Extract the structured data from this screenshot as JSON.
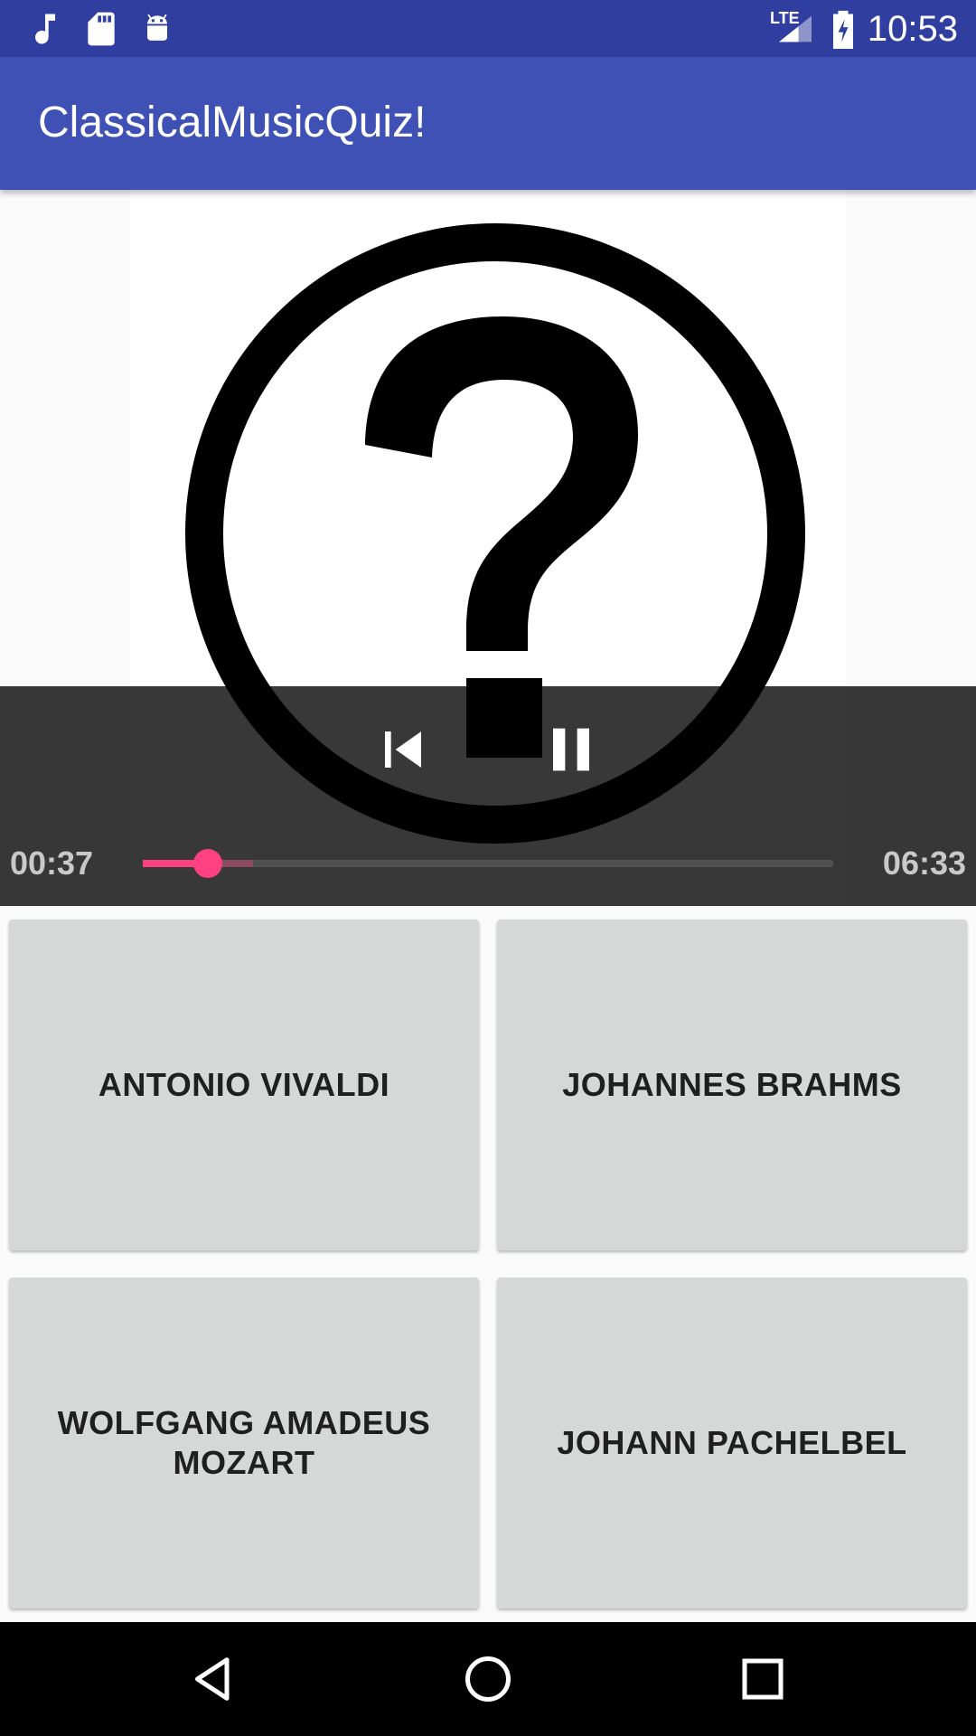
{
  "status_bar": {
    "time": "10:53",
    "network_label": "LTE",
    "left_icons": [
      "music-note-icon",
      "sd-card-icon",
      "android-icon"
    ],
    "right_icons": [
      "signal-icon",
      "battery-charging-icon"
    ]
  },
  "app_bar": {
    "title": "ClassicalMusicQuiz!"
  },
  "player": {
    "artwork_icon": "question-mark-circle-icon",
    "elapsed": "00:37",
    "duration": "06:33",
    "progress_fraction": 0.094,
    "buffered_fraction": 0.16,
    "buttons": [
      "previous-icon",
      "pause-icon"
    ]
  },
  "answers": [
    {
      "label": "ANTONIO VIVALDI"
    },
    {
      "label": "JOHANNES BRAHMS"
    },
    {
      "label": "WOLFGANG AMADEUS MOZART"
    },
    {
      "label": "JOHANN PACHELBEL"
    }
  ],
  "colors": {
    "status_bar": "#303f9f",
    "app_bar": "#3f51b5",
    "accent": "#ff4081",
    "answer_button": "#d6d7d7"
  },
  "nav_bar": {
    "buttons": [
      "back-icon",
      "home-icon",
      "recents-icon"
    ]
  }
}
